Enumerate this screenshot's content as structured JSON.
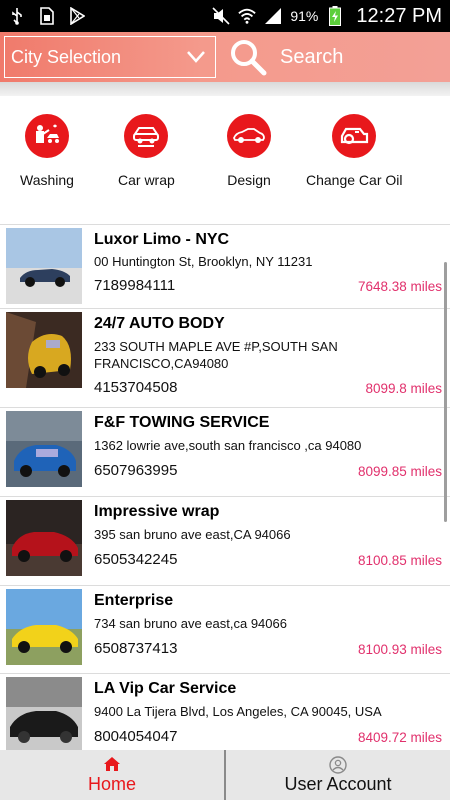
{
  "status_bar": {
    "battery": "91%",
    "time": "12:27 PM",
    "icons": [
      "usb-icon",
      "sim-icon",
      "play-store-icon",
      "mute-icon",
      "wifi-icon",
      "signal-icon",
      "battery-icon"
    ]
  },
  "header": {
    "city_select_label": "City Selection",
    "search_label": "Search"
  },
  "categories": [
    {
      "label": "Washing",
      "icon": "washing-icon"
    },
    {
      "label": "Car wrap",
      "icon": "car-wrap-icon"
    },
    {
      "label": "Design",
      "icon": "design-icon"
    },
    {
      "label": "Change Car  Oil",
      "icon": "oil-change-icon"
    }
  ],
  "listings": [
    {
      "name": "Luxor Limo - NYC",
      "address": "00 Huntington St, Brooklyn, NY 11231",
      "phone": "7189984111",
      "distance": "7648.38 miles"
    },
    {
      "name": "24/7 AUTO BODY",
      "address": "233 SOUTH MAPLE AVE #P,SOUTH SAN FRANCISCO,CA94080",
      "phone": "4153704508",
      "distance": "8099.8 miles"
    },
    {
      "name": "F&F TOWING SERVICE",
      "address": "1362 lowrie ave,south san francisco ,ca 94080",
      "phone": "6507963995",
      "distance": "8099.85 miles"
    },
    {
      "name": "Impressive wrap",
      "address": "395 san bruno ave east,CA 94066",
      "phone": "6505342245",
      "distance": "8100.85 miles"
    },
    {
      "name": "Enterprise",
      "address": "734 san bruno ave east,ca 94066",
      "phone": "6508737413",
      "distance": "8100.93 miles"
    },
    {
      "name": "LA Vip Car Service",
      "address": "9400 La Tijera Blvd, Los Angeles, CA 90045, USA",
      "phone": "8004054047",
      "distance": "8409.72 miles"
    }
  ],
  "bottom_nav": {
    "home_label": "Home",
    "account_label": "User Account"
  },
  "colors": {
    "accent": "#e8181c",
    "header": "#f28a7c",
    "distance": "#e1306c"
  }
}
